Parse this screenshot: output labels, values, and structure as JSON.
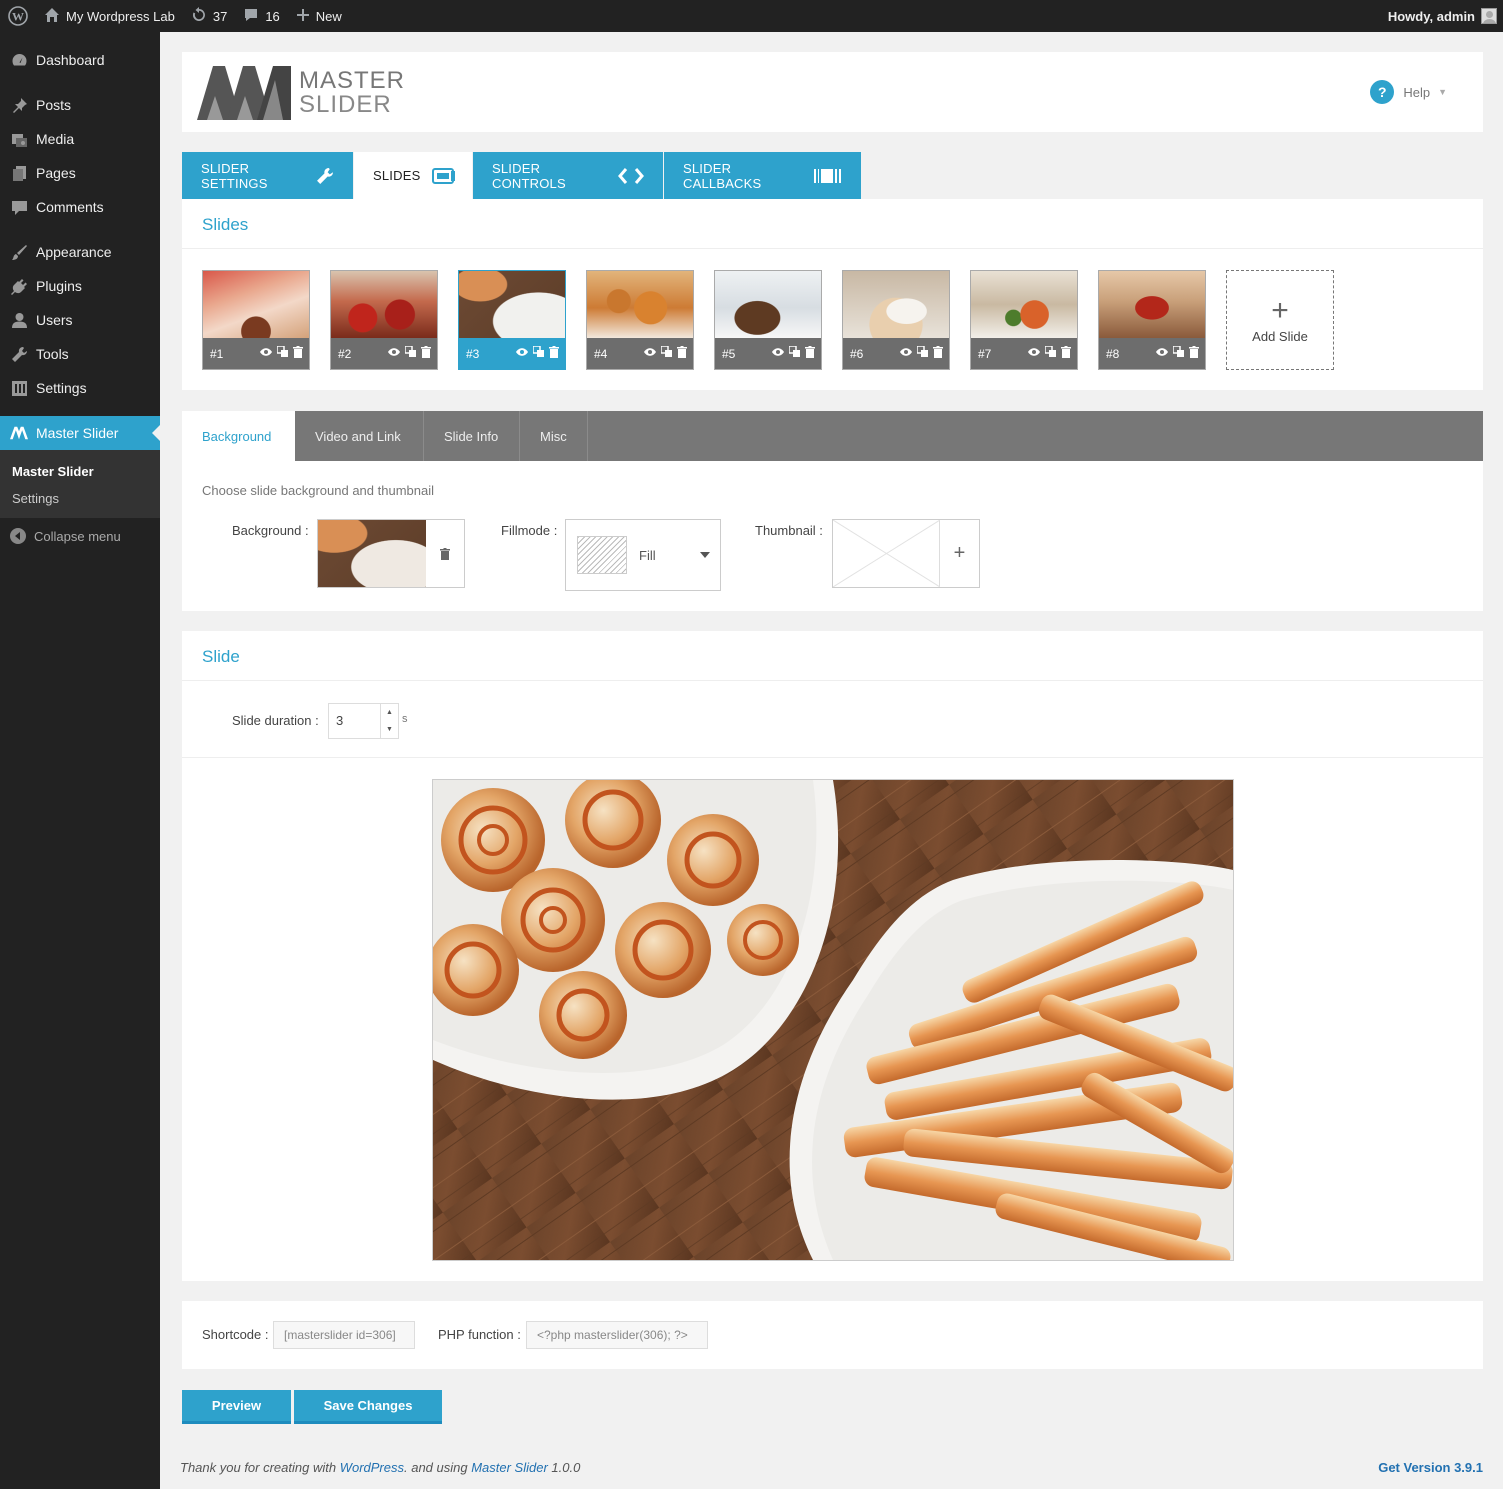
{
  "adminbar": {
    "site_name": "My Wordpress Lab",
    "updates_count": "37",
    "comments_count": "16",
    "new_label": "New",
    "howdy": "Howdy, admin"
  },
  "sidebar": {
    "items": [
      {
        "label": "Dashboard",
        "icon": "dashboard-icon"
      },
      {
        "label": "Posts",
        "icon": "pin-icon"
      },
      {
        "label": "Media",
        "icon": "media-icon"
      },
      {
        "label": "Pages",
        "icon": "pages-icon"
      },
      {
        "label": "Comments",
        "icon": "comment-icon"
      },
      {
        "label": "Appearance",
        "icon": "brush-icon"
      },
      {
        "label": "Plugins",
        "icon": "plug-icon"
      },
      {
        "label": "Users",
        "icon": "user-icon"
      },
      {
        "label": "Tools",
        "icon": "wrench-icon"
      },
      {
        "label": "Settings",
        "icon": "settings-icon"
      }
    ],
    "current": {
      "label": "Master Slider",
      "icon": "master-slider-icon"
    },
    "submenu": [
      "Master Slider",
      "Settings"
    ],
    "collapse": "Collapse menu"
  },
  "header": {
    "logo_line1": "MASTER",
    "logo_line2": "SLIDER",
    "help": "Help"
  },
  "main_tabs": [
    {
      "label": "SLIDER SETTINGS",
      "icon": "wrench-icon",
      "active": false
    },
    {
      "label": "SLIDES",
      "icon": "slides-icon",
      "active": true
    },
    {
      "label": "SLIDER CONTROLS",
      "icon": "arrows-icon",
      "active": false
    },
    {
      "label": "SLIDER CALLBACKS",
      "icon": "barcode-icon",
      "active": false
    }
  ],
  "slides": {
    "title": "Slides",
    "items": [
      "#1",
      "#2",
      "#3",
      "#4",
      "#5",
      "#6",
      "#7",
      "#8"
    ],
    "active_index": 2,
    "add_label": "Add Slide"
  },
  "sub_tabs": [
    "Background",
    "Video and Link",
    "Slide Info",
    "Misc"
  ],
  "background_section": {
    "hint": "Choose slide background and thumbnail",
    "background_label": "Background :",
    "fillmode_label": "Fillmode :",
    "fillmode_value": "Fill",
    "thumbnail_label": "Thumbnail :"
  },
  "slide_section": {
    "title": "Slide",
    "duration_label": "Slide duration :",
    "duration_value": "3",
    "duration_unit": "s"
  },
  "shortcode": {
    "label": "Shortcode :",
    "value": "[masterslider id=306]",
    "php_label": "PHP function :",
    "php_value": "<?php masterslider(306); ?>"
  },
  "buttons": {
    "preview": "Preview",
    "save": "Save Changes"
  },
  "footer": {
    "text_before": "Thank you for creating with ",
    "wordpress_link": "WordPress",
    "text_mid": ". and using ",
    "ms_link": "Master Slider",
    "text_after": " 1.0.0",
    "version": "Get Version 3.9.1"
  },
  "colors": {
    "accent": "#2ea2cc",
    "admin_dark": "#222222",
    "subtab_bar": "#777777"
  }
}
